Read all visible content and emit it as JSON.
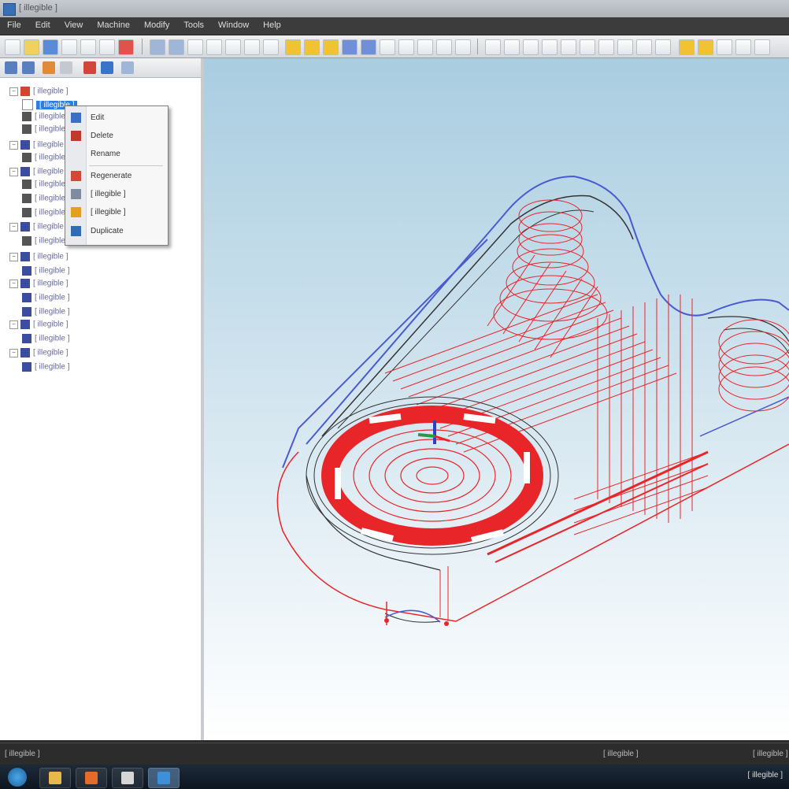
{
  "window": {
    "title": "[ illegible ]"
  },
  "menu": {
    "items": [
      "File",
      "Edit",
      "View",
      "Machine",
      "Modify",
      "Tools",
      "Window",
      "Help"
    ]
  },
  "toolbar": {
    "icons": [
      "new-icon",
      "open-icon",
      "save-icon",
      "print-icon",
      "undo-icon",
      "redo-icon",
      "cut-icon",
      "copy-icon",
      "paste-icon",
      "delete-icon"
    ]
  },
  "panel_tools": {
    "icons": [
      "select-all-icon",
      "select-icon",
      "regen-icon",
      "dirty-icon",
      "verify-icon",
      "simulate-icon",
      "post-icon"
    ]
  },
  "tree": {
    "items": [
      {
        "label": "[ illegible ]",
        "indent": 1,
        "kind": "group"
      },
      {
        "label": "[ illegible ]",
        "indent": 2,
        "kind": "op",
        "selected": true
      },
      {
        "label": "[ illegible ]",
        "indent": 2,
        "kind": "op"
      },
      {
        "label": "[ illegible ]",
        "indent": 2,
        "kind": "op"
      },
      {
        "label": "[ illegible ]",
        "indent": 1,
        "kind": "group"
      },
      {
        "label": "[ illegible ]",
        "indent": 2,
        "kind": "op"
      },
      {
        "label": "[ illegible ]",
        "indent": 1,
        "kind": "group"
      },
      {
        "label": "[ illegible ]",
        "indent": 2,
        "kind": "op"
      },
      {
        "label": "[ illegible ]",
        "indent": 2,
        "kind": "op"
      },
      {
        "label": "[ illegible ]",
        "indent": 2,
        "kind": "op"
      },
      {
        "label": "[ illegible ]",
        "indent": 1,
        "kind": "group"
      },
      {
        "label": "[ illegible ]",
        "indent": 2,
        "kind": "op"
      },
      {
        "label": "[ illegible ]",
        "indent": 1,
        "kind": "group"
      },
      {
        "label": "[ illegible ]",
        "indent": 2,
        "kind": "op"
      },
      {
        "label": "[ illegible ]",
        "indent": 1,
        "kind": "group"
      },
      {
        "label": "[ illegible ]",
        "indent": 2,
        "kind": "op"
      },
      {
        "label": "[ illegible ]",
        "indent": 2,
        "kind": "op"
      },
      {
        "label": "[ illegible ]",
        "indent": 1,
        "kind": "group"
      },
      {
        "label": "[ illegible ]",
        "indent": 2,
        "kind": "op"
      },
      {
        "label": "[ illegible ]",
        "indent": 1,
        "kind": "group"
      },
      {
        "label": "[ illegible ]",
        "indent": 2,
        "kind": "op"
      }
    ]
  },
  "context_menu": {
    "items": [
      {
        "label": "Edit",
        "icon": "edit-icon",
        "color": "#3b6fc7"
      },
      {
        "label": "Delete",
        "icon": "delete-icon",
        "color": "#c0392b"
      },
      {
        "label": "Rename",
        "icon": "",
        "color": ""
      },
      {
        "label": "Regenerate",
        "icon": "regen-icon",
        "color": "#d04a3a"
      },
      {
        "label": "[ illegible ]",
        "icon": "dirty-icon",
        "color": "#7f8ca0"
      },
      {
        "label": "[ illegible ]",
        "icon": "toolpath-icon",
        "color": "#e0a020"
      },
      {
        "label": "Duplicate",
        "icon": "duplicate-icon",
        "color": "#2e6db3"
      }
    ]
  },
  "status": {
    "left": "[ illegible ]",
    "right": "[ illegible ]",
    "corner": "[ illegible ]"
  },
  "taskbar": {
    "apps": [
      "folder-icon",
      "media-icon",
      "explorer-icon",
      "cam-app-icon"
    ],
    "clock": "[ illegible ]"
  },
  "colors": {
    "toolpath": "#e8262a",
    "stock_outline": "#4a5bd0",
    "geometry": "#2a2a2a",
    "selection": "#2f7de1"
  }
}
